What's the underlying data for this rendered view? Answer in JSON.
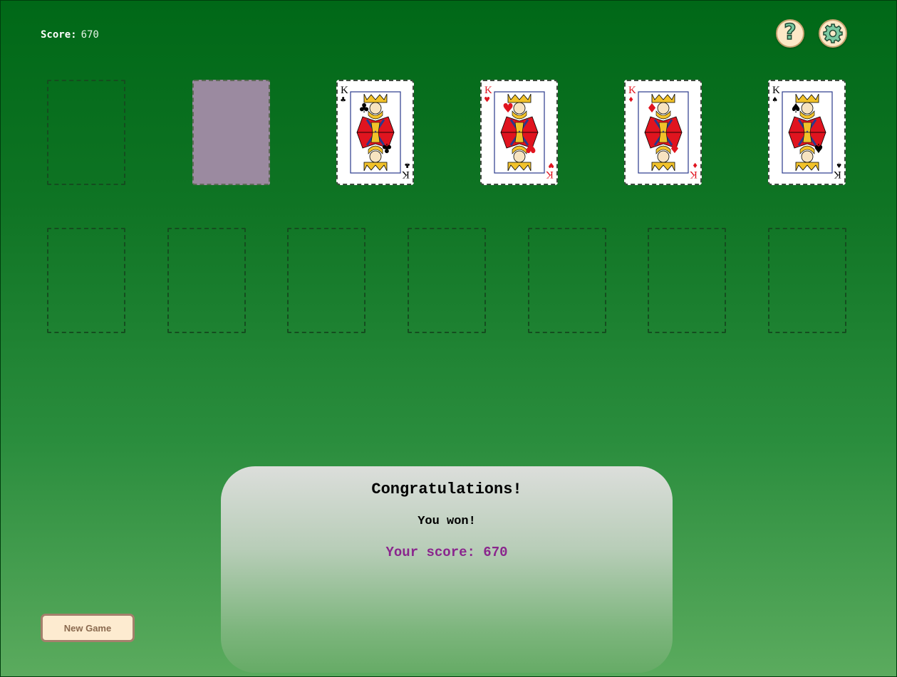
{
  "header": {
    "score_label": "Score:",
    "score_value": "670",
    "help_icon": "question-mark-icon",
    "settings_icon": "gear-icon",
    "help_glyph": "?"
  },
  "foundations": [
    {
      "rank": "K",
      "suit": "♣",
      "color": "black",
      "name": "king-of-clubs"
    },
    {
      "rank": "K",
      "suit": "♥",
      "color": "red",
      "name": "king-of-hearts"
    },
    {
      "rank": "K",
      "suit": "♦",
      "color": "red",
      "name": "king-of-diamonds"
    },
    {
      "rank": "K",
      "suit": "♠",
      "color": "black",
      "name": "king-of-spades"
    }
  ],
  "dialog": {
    "title": "Congratulations!",
    "message": "You won!",
    "score_text": "Your score: 670"
  },
  "buttons": {
    "new_game": "New Game"
  },
  "colors": {
    "felt_top": "#006817",
    "felt_bottom": "#5bab5e",
    "card_back": "#9b8aa0",
    "score_text": "#8a268d",
    "button_bg": "#fdebd0"
  }
}
